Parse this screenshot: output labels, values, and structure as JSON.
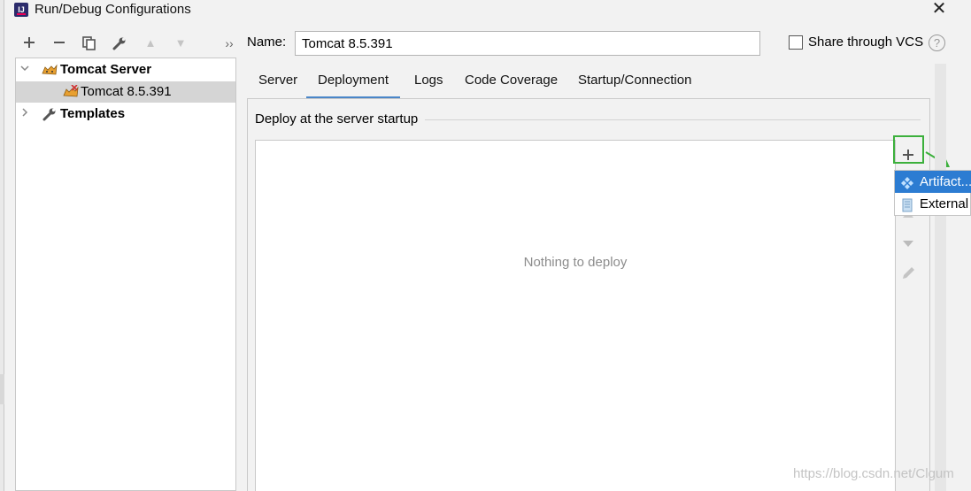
{
  "window": {
    "title": "Run/Debug Configurations"
  },
  "toolbar": {
    "buttons": [
      "add-icon",
      "remove-icon",
      "copy-icon",
      "wrench-icon",
      "move-up-icon",
      "move-down-icon",
      "more-icon"
    ],
    "more_label": "››"
  },
  "tree": {
    "group": {
      "label": "Tomcat Server",
      "expanded": true
    },
    "item": {
      "label": "Tomcat 8.5.391",
      "selected": true
    },
    "templates": {
      "label": "Templates",
      "expanded": false
    }
  },
  "form": {
    "name_label": "Name:",
    "name_value": "Tomcat 8.5.391",
    "share_label": "Share through VCS",
    "share_checked": false
  },
  "tabs": [
    {
      "label": "Server",
      "active": false
    },
    {
      "label": "Deployment",
      "active": true
    },
    {
      "label": "Logs",
      "active": false
    },
    {
      "label": "Code Coverage",
      "active": false
    },
    {
      "label": "Startup/Connection",
      "active": false
    }
  ],
  "deployment": {
    "section_title": "Deploy at the server startup",
    "empty_text": "Nothing to deploy"
  },
  "popup": {
    "items": [
      {
        "label": "Artifact...",
        "icon": "artifact-icon",
        "selected": true
      },
      {
        "label": "External Source...",
        "icon": "external-source-icon",
        "selected": false
      }
    ]
  },
  "watermark": "https://blog.csdn.net/Clgum",
  "colors": {
    "accent": "#4a86c8",
    "highlight": "#3cb03c",
    "popup_selected": "#2c7cd2"
  }
}
